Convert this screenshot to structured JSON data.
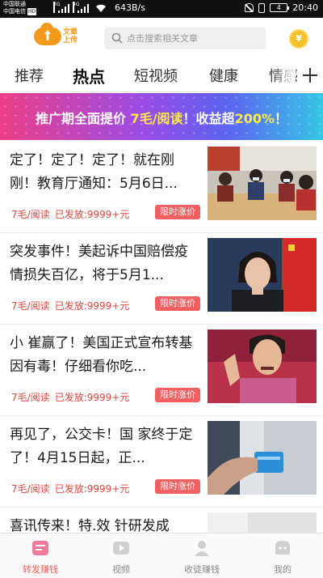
{
  "status_bar": {
    "carrier_1": "中国联通",
    "carrier_2": "中国电信",
    "carrier_2_badge": "HD",
    "network_1": "3G",
    "network_2": "4G",
    "speed": "643B/s",
    "battery": "4",
    "time": "20:40",
    "icons": [
      "signal-icon",
      "wifi-icon",
      "mute-bell-icon",
      "vibrate-icon",
      "battery-icon"
    ]
  },
  "header": {
    "upload_label": "文章上传",
    "search_placeholder": "点击搜索相关文章",
    "coin_symbol": "¥",
    "accent_color": "#f39a1c"
  },
  "tabs": {
    "items": [
      {
        "label": "推荐",
        "active": false
      },
      {
        "label": "热点",
        "active": true
      },
      {
        "label": "短视频",
        "active": false
      },
      {
        "label": "健康",
        "active": false
      },
      {
        "label": "情感",
        "active": false
      }
    ]
  },
  "banner": {
    "part1": "推广期全面提价 ",
    "price": "7毛/阅读",
    "part2": "！收益超",
    "percent": "200%",
    "part3": "！"
  },
  "articles": [
    {
      "title": "定了！定了！定了！就在刚刚！教育厅通知：5月6日...",
      "rate": "7毛/阅读",
      "paid": "已发放:9999+元",
      "badge": "限时涨价"
    },
    {
      "title": "突发事件！美起诉中国赔偿疫情损失百亿，将于5月1...",
      "rate": "7毛/阅读",
      "paid": "已发放:9999+元",
      "badge": "限时涨价"
    },
    {
      "title": "小 崔赢了！美国正式宣布转基因有毒！仔细看你吃...",
      "rate": "7毛/阅读",
      "paid": "已发放:9999+元",
      "badge": "限时涨价"
    },
    {
      "title": "再见了，公交卡！国 家终于定了！4月15日起，正...",
      "rate": "7毛/阅读",
      "paid": "已发放:9999+元",
      "badge": "限时涨价"
    },
    {
      "title": "喜讯传来！特.效 针研发成"
    }
  ],
  "bottom_nav": {
    "items": [
      {
        "label": "转发赚钱",
        "icon": "share-earn-icon",
        "active": true
      },
      {
        "label": "视频",
        "icon": "video-icon",
        "active": false
      },
      {
        "label": "收徒赚钱",
        "icon": "person-icon",
        "active": false
      },
      {
        "label": "我的",
        "icon": "profile-icon",
        "active": false
      }
    ],
    "active_color": "#f05b5b"
  }
}
